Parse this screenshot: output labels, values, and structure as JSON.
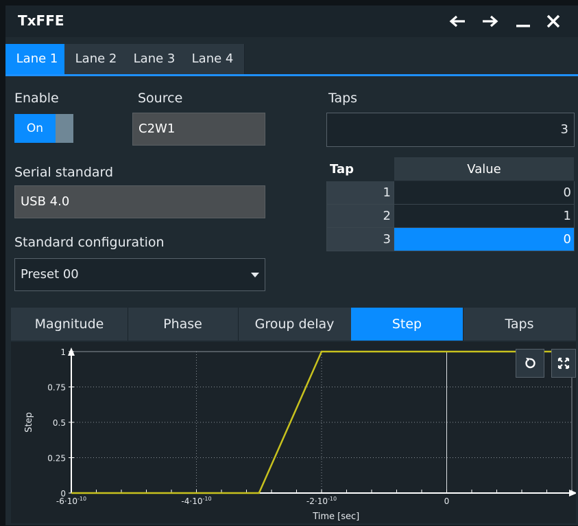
{
  "window": {
    "title": "TxFFE"
  },
  "lanes": [
    "Lane 1",
    "Lane 2",
    "Lane 3",
    "Lane 4"
  ],
  "enable": {
    "label": "Enable",
    "state": "On"
  },
  "source": {
    "label": "Source",
    "value": "C2W1"
  },
  "serial_standard": {
    "label": "Serial standard",
    "value": "USB 4.0"
  },
  "standard_configuration": {
    "label": "Standard configuration",
    "value": "Preset 00"
  },
  "taps": {
    "label": "Taps",
    "value": "3",
    "table": {
      "headers": [
        "Tap",
        "Value"
      ],
      "rows": [
        {
          "tap": "1",
          "value": "0"
        },
        {
          "tap": "2",
          "value": "1"
        },
        {
          "tap": "3",
          "value": "0"
        }
      ]
    }
  },
  "plot_tabs": [
    "Magnitude",
    "Phase",
    "Group delay",
    "Step",
    "Taps"
  ],
  "plot_tabs_active": "Step",
  "colors": {
    "accent": "#0a8cff",
    "trace": "#c8c21e"
  },
  "chart_data": {
    "type": "line",
    "xlabel": "Time [sec]",
    "ylabel": "Step",
    "x_tick_labels": [
      "-6·10-10",
      "-4·10-10",
      "-2·10-10",
      "0"
    ],
    "y_tick_labels": [
      "0",
      "0.25",
      "0.5",
      "0.75",
      "1"
    ],
    "xlim": [
      -6e-10,
      2e-10
    ],
    "ylim": [
      0,
      1
    ],
    "series": [
      {
        "x": [
          -6e-10,
          -3e-10,
          -2e-10,
          2e-10
        ],
        "y": [
          0,
          0,
          1,
          1
        ]
      }
    ]
  }
}
